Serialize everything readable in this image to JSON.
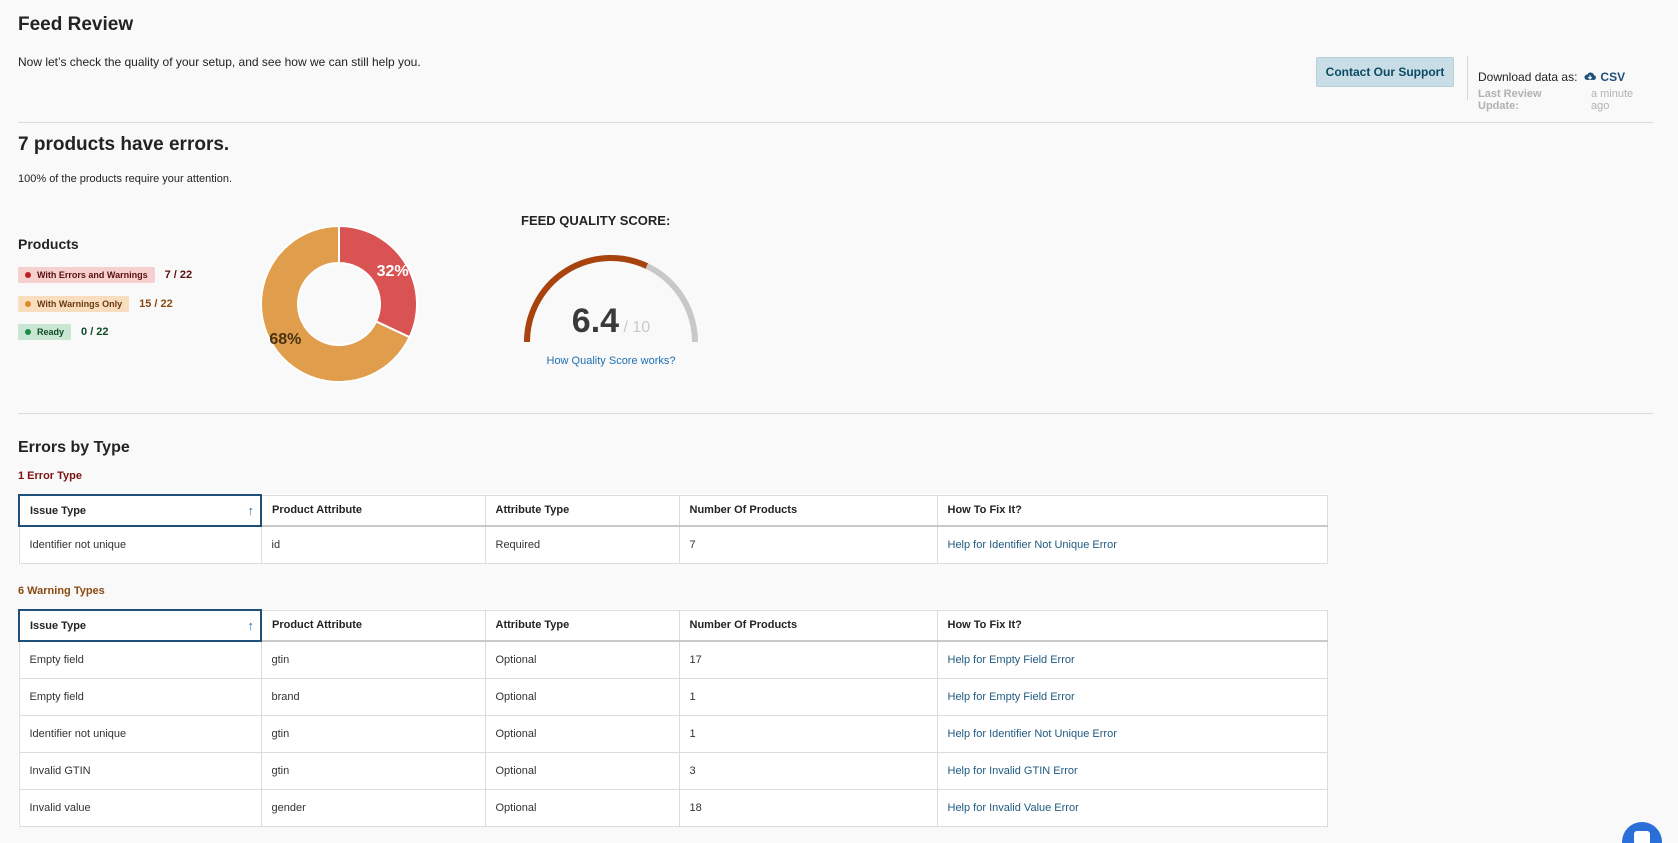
{
  "header": {
    "title": "Feed Review",
    "subtitle": "Now let’s check the quality of your setup, and see how we can still help you.",
    "support_button": "Contact Our Support",
    "download_label": "Download data as:",
    "csv_label": "CSV",
    "last_update_label": "Last Review Update:",
    "last_update_value": "a minute ago"
  },
  "summary": {
    "headline": "7 products have errors.",
    "subline": "100% of the products require your attention."
  },
  "products": {
    "title": "Products",
    "legend": [
      {
        "label": "With Errors and Warnings",
        "count": "7 / 22",
        "color": "#c0201c"
      },
      {
        "label": "With Warnings Only",
        "count": "15 / 22",
        "color": "#e0872c"
      },
      {
        "label": "Ready",
        "count": "0 / 22",
        "color": "#1d8a47"
      }
    ]
  },
  "chart_data": {
    "type": "pie",
    "categories": [
      "With Errors and Warnings",
      "With Warnings Only"
    ],
    "values": [
      32,
      68
    ],
    "labels": [
      "32%",
      "68%"
    ],
    "colors": [
      "#d95352",
      "#e09e4c"
    ]
  },
  "quality": {
    "title": "FEED QUALITY SCORE:",
    "score": "6.4",
    "max": "/ 10",
    "score_value": 6.4,
    "score_max": 10,
    "link": "How Quality Score works?",
    "colors": {
      "fill": "#a8430e",
      "track": "#c8c8c8"
    }
  },
  "errors_section": {
    "title": "Errors by Type",
    "error_count": "1 Error Type",
    "warning_count": "6 Warning Types"
  },
  "columns": [
    "Issue Type",
    "Product Attribute",
    "Attribute Type",
    "Number Of Products",
    "How To Fix It?"
  ],
  "error_rows": [
    [
      "Identifier not unique",
      "id",
      "Required",
      "7",
      "Help for Identifier Not Unique Error"
    ]
  ],
  "warning_rows": [
    [
      "Empty field",
      "gtin",
      "Optional",
      "17",
      "Help for Empty Field Error"
    ],
    [
      "Empty field",
      "brand",
      "Optional",
      "1",
      "Help for Empty Field Error"
    ],
    [
      "Identifier not unique",
      "gtin",
      "Optional",
      "1",
      "Help for Identifier Not Unique Error"
    ],
    [
      "Invalid GTIN",
      "gtin",
      "Optional",
      "3",
      "Help for Invalid GTIN Error"
    ],
    [
      "Invalid value",
      "gender",
      "Optional",
      "18",
      "Help for Invalid Value Error"
    ]
  ]
}
